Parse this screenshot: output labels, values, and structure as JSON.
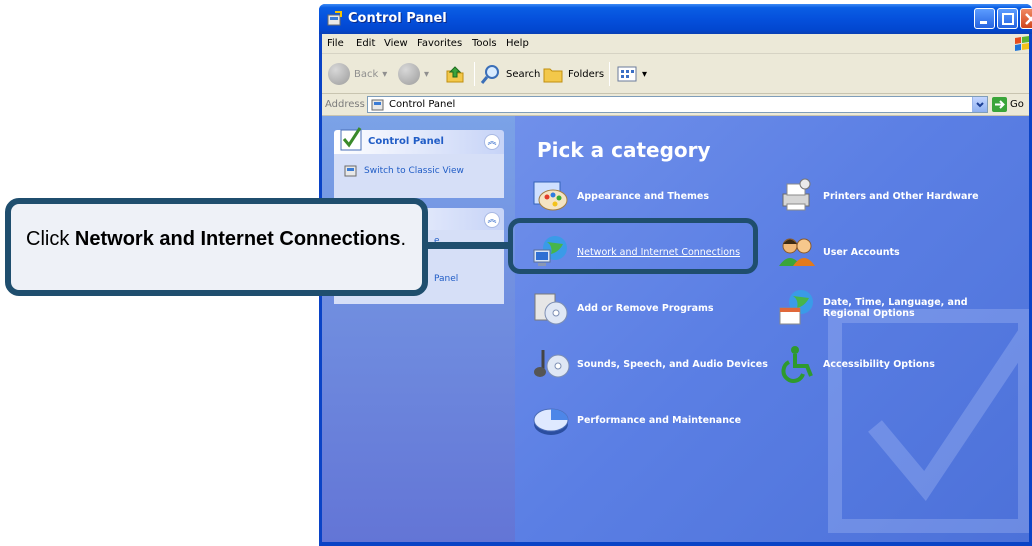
{
  "window": {
    "title": "Control Panel"
  },
  "menu": [
    "File",
    "Edit",
    "View",
    "Favorites",
    "Tools",
    "Help"
  ],
  "toolbar": {
    "back": "Back",
    "search": "Search",
    "folders": "Folders"
  },
  "address": {
    "label": "Address",
    "value": "Control Panel",
    "go": "Go"
  },
  "taskpane": {
    "header": "Control Panel",
    "switch_link": "Switch to Classic View",
    "see_also_fragments": [
      "e",
      "Panel"
    ]
  },
  "main": {
    "heading": "Pick a category",
    "categories": [
      {
        "label": "Appearance and Themes",
        "icon": "appearance-icon"
      },
      {
        "label": "Printers and Other Hardware",
        "icon": "printer-icon"
      },
      {
        "label": "Network and Internet Connections",
        "icon": "network-icon"
      },
      {
        "label": "User Accounts",
        "icon": "users-icon"
      },
      {
        "label": "Add or Remove Programs",
        "icon": "programs-icon"
      },
      {
        "label": "Date, Time, Language, and Regional Options",
        "icon": "datetime-icon"
      },
      {
        "label": "Sounds, Speech, and Audio Devices",
        "icon": "sound-icon"
      },
      {
        "label": "Accessibility Options",
        "icon": "accessibility-icon"
      },
      {
        "label": "Performance and Maintenance",
        "icon": "performance-icon"
      }
    ]
  },
  "callout": {
    "prefix": "Click",
    "bold": "Network and Internet Connections",
    "suffix": "."
  },
  "colors": {
    "title_bar": "#0550dc",
    "content_bg": "#5b7fe4",
    "callout_border": "#1f4e6e"
  }
}
